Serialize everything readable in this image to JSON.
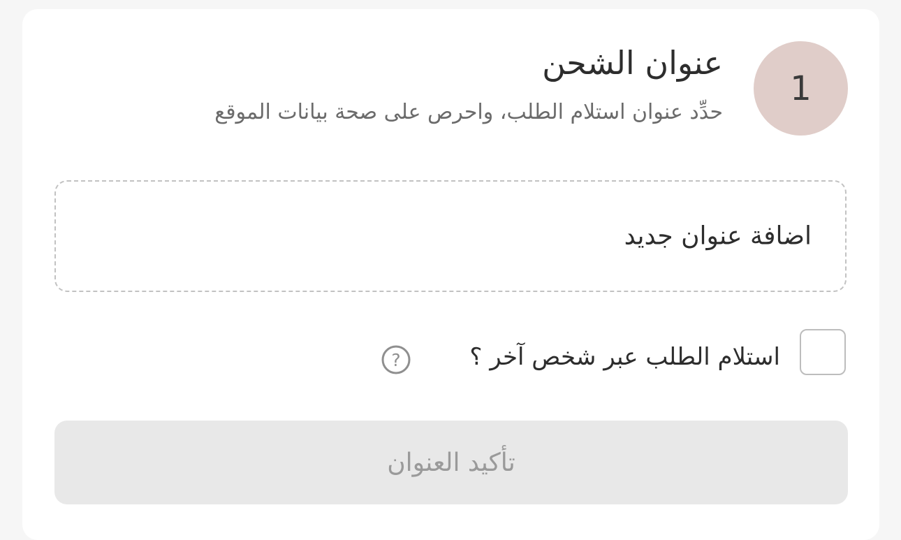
{
  "step": {
    "number": "1",
    "title": "عنوان الشحن",
    "subtitle": "حدِّد عنوان استلام الطلب، واحرص على صحة بيانات الموقع"
  },
  "add_address": {
    "label": "اضافة عنوان جديد"
  },
  "receive_by_other": {
    "label": "استلام الطلب عبر شخص آخر ؟",
    "checked": false,
    "help_icon": "question-circle-icon"
  },
  "confirm_button": {
    "label": "تأكيد العنوان",
    "disabled": true
  },
  "colors": {
    "step_circle": "#e0cdc9",
    "button_bg": "#e8e8e8",
    "button_text": "#9a9a9a",
    "page_bg": "#f6f6f6"
  }
}
